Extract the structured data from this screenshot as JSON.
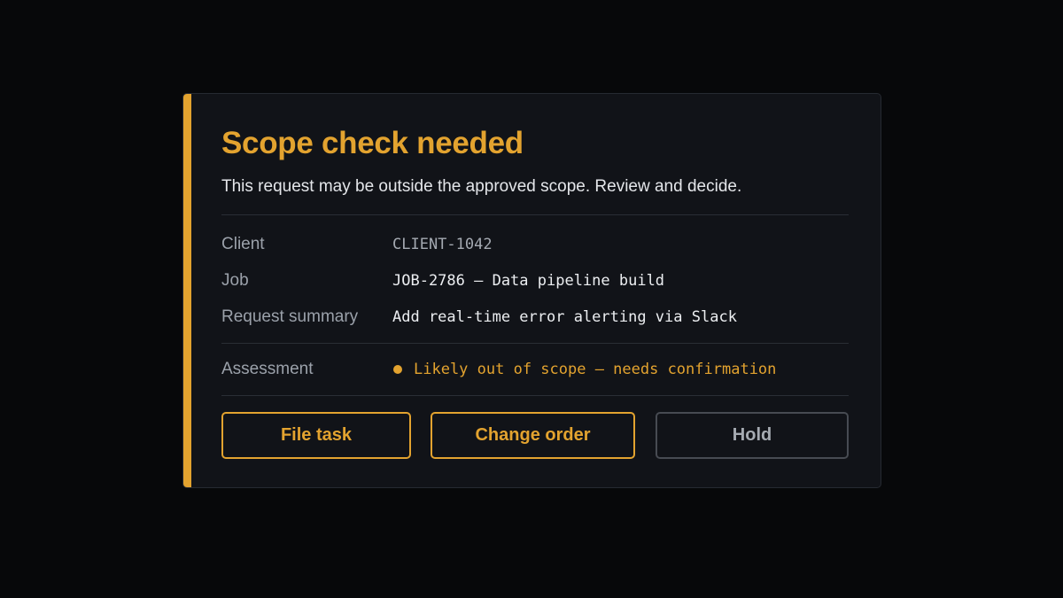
{
  "card": {
    "title": "Scope check needed",
    "subtitle": "This request may be outside the approved scope. Review and decide.",
    "accent_color": "#e3a32f"
  },
  "details": [
    {
      "label": "Client",
      "value": "CLIENT-1042"
    },
    {
      "label": "Job",
      "value": "JOB-2786 — Data pipeline build"
    },
    {
      "label": "Request summary",
      "value": "Add real-time error alerting via Slack"
    }
  ],
  "assessment": {
    "label": "Assessment",
    "value": "Likely out of scope — needs confirmation",
    "status_color": "#e3a32f",
    "status_icon": "warning-dot-icon"
  },
  "actions": {
    "file_task": "File task",
    "change_order": "Change order",
    "hold": "Hold"
  }
}
